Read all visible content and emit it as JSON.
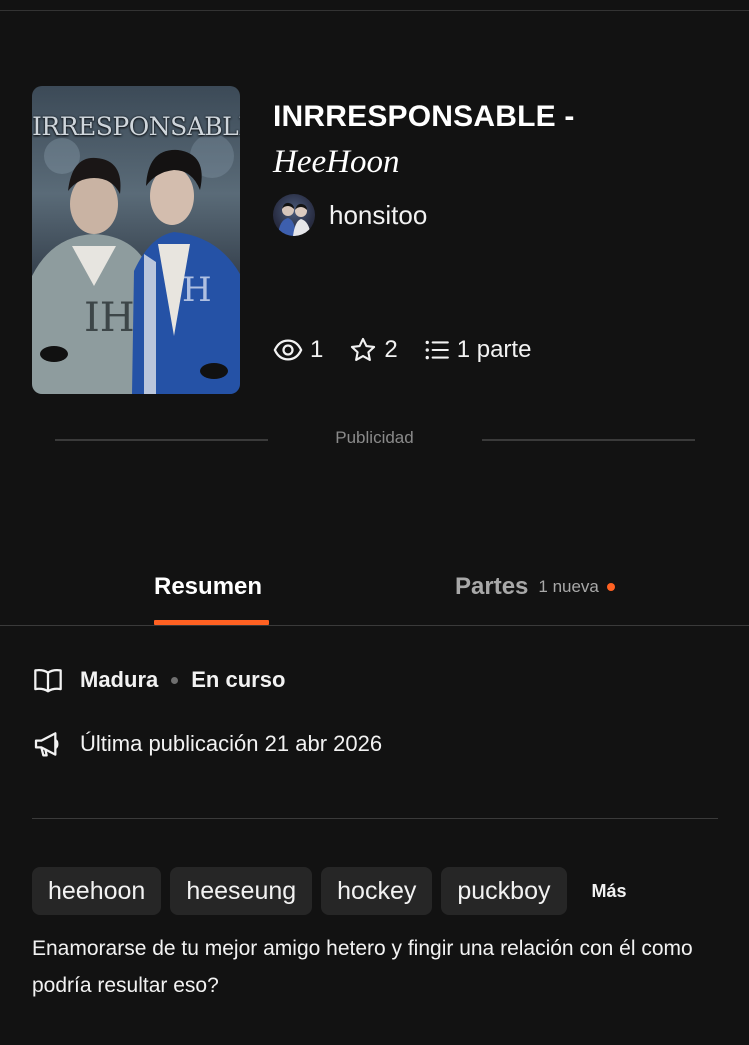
{
  "story": {
    "cover_title": "IRRESPONSABLE",
    "title_line1": "INRRESPONSABLE -",
    "title_line2": "HeeHoon",
    "author": "honsitoo"
  },
  "stats": {
    "reads": "1",
    "votes": "2",
    "parts": "1 parte"
  },
  "ad": {
    "label": "Publicidad"
  },
  "tabs": {
    "summary": "Resumen",
    "parts": "Partes",
    "parts_badge": "1 nueva"
  },
  "details": {
    "rating": "Madura",
    "status": "En curso",
    "last_published": "Última publicación 21 abr 2026"
  },
  "tags": [
    "heehoon",
    "heeseung",
    "hockey",
    "puckboy"
  ],
  "tags_more": "Más",
  "description": "Enamorarse de tu mejor amigo hetero y fingir una relación con él como podría resultar eso?",
  "colors": {
    "background": "#121212",
    "accent": "#ff6122",
    "tag_bg": "#262626",
    "muted": "#a8a8a8"
  },
  "icons": [
    "eye-icon",
    "star-icon",
    "list-icon",
    "book-icon",
    "megaphone-icon"
  ]
}
